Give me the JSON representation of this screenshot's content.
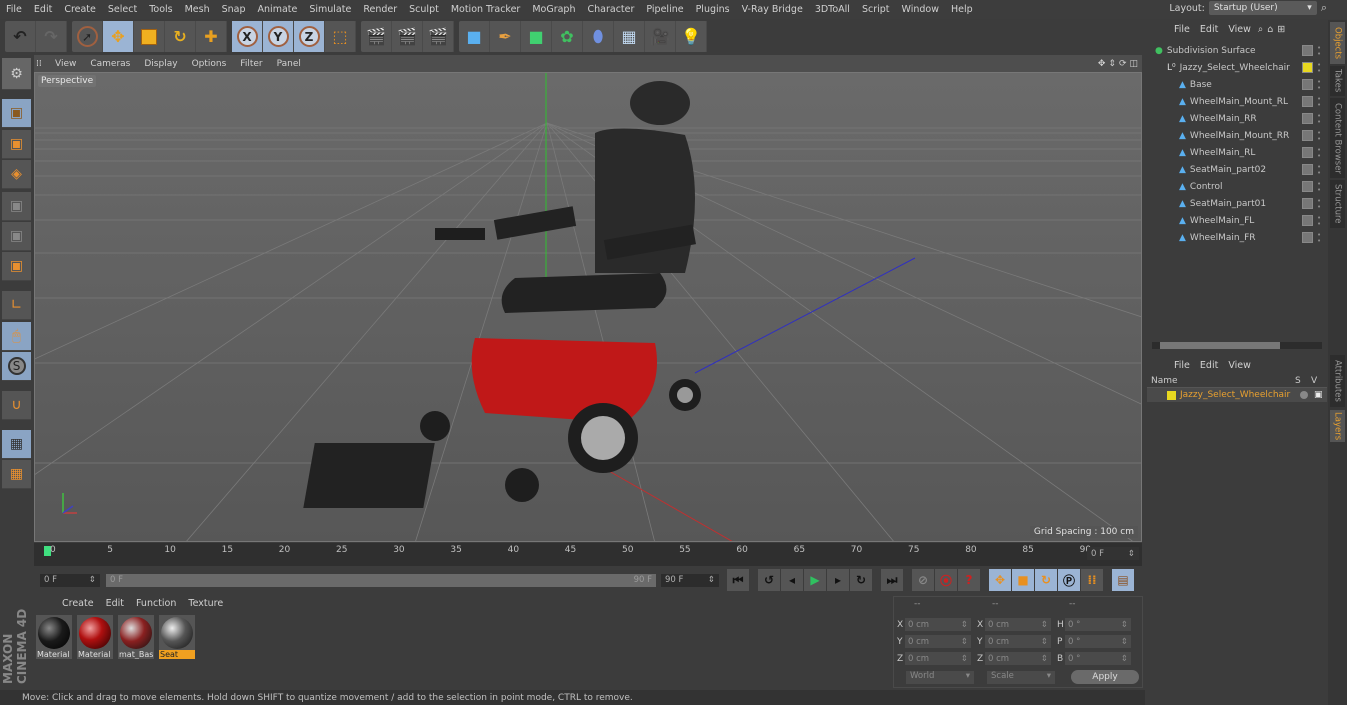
{
  "menubar": {
    "items": [
      "File",
      "Edit",
      "Create",
      "Select",
      "Tools",
      "Mesh",
      "Snap",
      "Animate",
      "Simulate",
      "Render",
      "Sculpt",
      "Motion Tracker",
      "MoGraph",
      "Character",
      "Pipeline",
      "Plugins",
      "V-Ray Bridge",
      "3DToAll",
      "Script",
      "Window",
      "Help"
    ],
    "layout_label": "Layout:",
    "layout_value": "Startup (User)"
  },
  "toolbar": {
    "undo": "undo-icon",
    "redo": "redo-icon",
    "tools": [
      "select-icon",
      "move-icon",
      "scale-icon",
      "rotate-icon",
      "last-tool-icon"
    ],
    "axes": [
      "X",
      "Y",
      "Z"
    ],
    "coord_system": "world-coordinate-icon",
    "render": [
      "render-view-icon",
      "render-picture-viewer-icon",
      "render-settings-icon"
    ],
    "objects": [
      "cube-icon",
      "pen-spline-icon",
      "subdivision-icon",
      "mograph-cloner-icon",
      "deformer-icon",
      "floor-icon",
      "camera-icon",
      "light-icon"
    ]
  },
  "left_toolbar": [
    "make-editable-icon",
    "model-mode-icon",
    "texture-mode-icon",
    "workplane-icon",
    "points-mode-icon",
    "edges-mode-icon",
    "polygons-mode-icon",
    "axis-mode-icon",
    "tweak-mode-icon",
    "solo-icon",
    "snap-icon",
    "lock-workplane-icon",
    "planar-workplane-icon"
  ],
  "viewport": {
    "menu": [
      "View",
      "Cameras",
      "Display",
      "Options",
      "Filter",
      "Panel"
    ],
    "camera_label": "Perspective",
    "grid_spacing": "Grid Spacing : 100 cm",
    "nav_icons": [
      "pan-icon",
      "dolly-icon",
      "orbit-icon",
      "maximize-icon"
    ]
  },
  "timeline": {
    "ticks": [
      "0",
      "5",
      "10",
      "15",
      "20",
      "25",
      "30",
      "35",
      "40",
      "45",
      "50",
      "55",
      "60",
      "65",
      "70",
      "75",
      "80",
      "85",
      "90"
    ],
    "current_frame_field": "0 F",
    "start_field": "0 F",
    "range_start": "0 F",
    "range_end": "90 F",
    "end_field": "90 F",
    "playhead_frame": 0
  },
  "playback": [
    "go-to-start-icon",
    "previous-key-icon",
    "previous-frame-icon",
    "play-icon",
    "next-frame-icon",
    "next-key-icon",
    "go-to-end-icon"
  ],
  "record": [
    "motion-record-icon",
    "record-active-icon",
    "autokey-icon"
  ],
  "key_tracks": [
    "position-key-icon",
    "scale-key-icon",
    "rotation-key-icon",
    "parameter-key-icon",
    "point-level-icon",
    "timeline-icon"
  ],
  "materials": {
    "menu": [
      "Create",
      "Edit",
      "Function",
      "Texture"
    ],
    "items": [
      {
        "label": "Material",
        "color": "#1a1a1a",
        "selected": false
      },
      {
        "label": "Material",
        "color": "#8a1010",
        "selected": false
      },
      {
        "label": "mat_Bas",
        "color": "#6a2a2a",
        "selected": false
      },
      {
        "label": "Seat",
        "color": "#3a3a3a",
        "selected": true
      }
    ]
  },
  "coordinates": {
    "headers": [
      "--",
      "--",
      "--"
    ],
    "rows": [
      {
        "a": "X",
        "av": "0 cm",
        "b": "X",
        "bv": "0 cm",
        "c": "H",
        "cv": "0 °"
      },
      {
        "a": "Y",
        "av": "0 cm",
        "b": "Y",
        "bv": "0 cm",
        "c": "P",
        "cv": "0 °"
      },
      {
        "a": "Z",
        "av": "0 cm",
        "b": "Z",
        "bv": "0 cm",
        "c": "B",
        "cv": "0 °"
      }
    ],
    "mode1": "World",
    "mode2": "Scale",
    "apply": "Apply"
  },
  "status": "Move: Click and drag to move elements. Hold down SHIFT to quantize movement / add to the selection in point mode, CTRL to remove.",
  "objects_panel": {
    "menu": [
      "File",
      "Edit",
      "View"
    ],
    "tree": [
      {
        "name": "Subdivision Surface",
        "level": 0,
        "icon": "subdivision-icon"
      },
      {
        "name": "Jazzy_Select_Wheelchair",
        "level": 1,
        "icon": "null-icon"
      },
      {
        "name": "Base",
        "level": 2,
        "icon": "polygon-icon"
      },
      {
        "name": "WheelMain_Mount_RL",
        "level": 2,
        "icon": "polygon-icon"
      },
      {
        "name": "WheelMain_RR",
        "level": 2,
        "icon": "polygon-icon"
      },
      {
        "name": "WheelMain_Mount_RR",
        "level": 2,
        "icon": "polygon-icon"
      },
      {
        "name": "WheelMain_RL",
        "level": 2,
        "icon": "polygon-icon"
      },
      {
        "name": "SeatMain_part02",
        "level": 2,
        "icon": "polygon-icon"
      },
      {
        "name": "Control",
        "level": 2,
        "icon": "polygon-icon"
      },
      {
        "name": "SeatMain_part01",
        "level": 2,
        "icon": "polygon-icon"
      },
      {
        "name": "WheelMain_FL",
        "level": 2,
        "icon": "polygon-icon"
      },
      {
        "name": "WheelMain_FR",
        "level": 2,
        "icon": "polygon-icon"
      }
    ]
  },
  "layers_panel": {
    "menu": [
      "File",
      "Edit",
      "View"
    ],
    "col_name": "Name",
    "col_s": "S",
    "col_v": "V",
    "layers": [
      {
        "name": "Jazzy_Select_Wheelchair",
        "color": "#e8d820"
      }
    ]
  },
  "side_tabs": {
    "top": [
      "Objects",
      "Takes",
      "Content Browser",
      "Structure"
    ],
    "bottom": [
      "Attributes",
      "Layers"
    ]
  },
  "brand": "MAXON CINEMA 4D"
}
